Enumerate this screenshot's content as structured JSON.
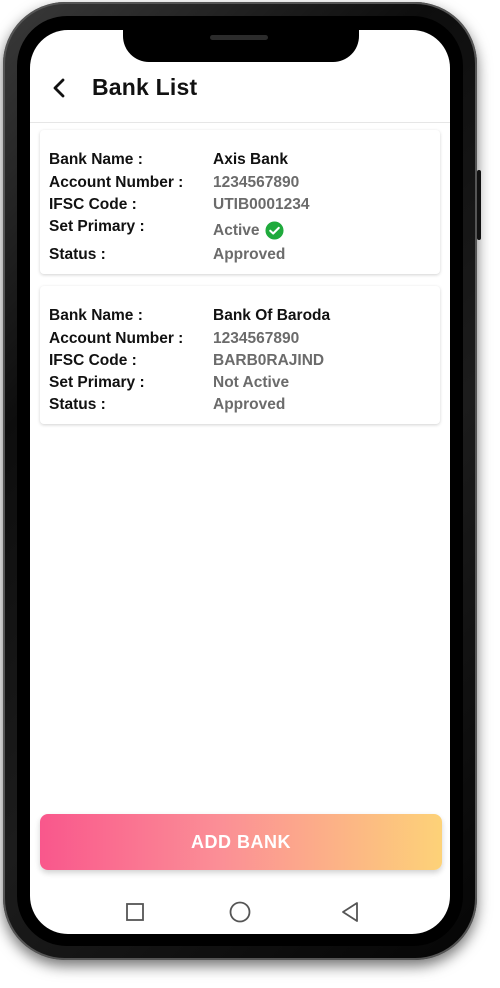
{
  "header": {
    "title": "Bank List",
    "back_icon": "chevron-left-icon"
  },
  "accounts": [
    {
      "bank_name_label": "Bank Name :",
      "bank_name": "Axis Bank",
      "account_number_label": "Account Number :",
      "account_number": "1234567890",
      "ifsc_label": "IFSC Code :",
      "ifsc": "UTIB0001234",
      "set_primary_label": "Set Primary :",
      "set_primary": "Active",
      "status_label": "Status :",
      "status": "Approved",
      "primary_icon": "check-circle-icon"
    },
    {
      "bank_name_label": "Bank Name :",
      "bank_name": "Bank Of Baroda",
      "account_number_label": "Account Number :",
      "account_number": "1234567890",
      "ifsc_label": "IFSC Code :",
      "ifsc": "BARB0RAJIND",
      "set_primary_label": "Set Primary :",
      "set_primary": "Not Active",
      "status_label": "Status :",
      "status": "Approved"
    }
  ],
  "add_button": {
    "label": "ADD BANK"
  },
  "nav": {
    "recents_icon": "square-icon",
    "home_icon": "circle-icon",
    "back_icon": "triangle-back-icon"
  },
  "colors": {
    "accent_start": "#f9578c",
    "accent_end": "#fdd278",
    "active_check": "#1faa3c",
    "value_grey": "#6b6b6b"
  }
}
